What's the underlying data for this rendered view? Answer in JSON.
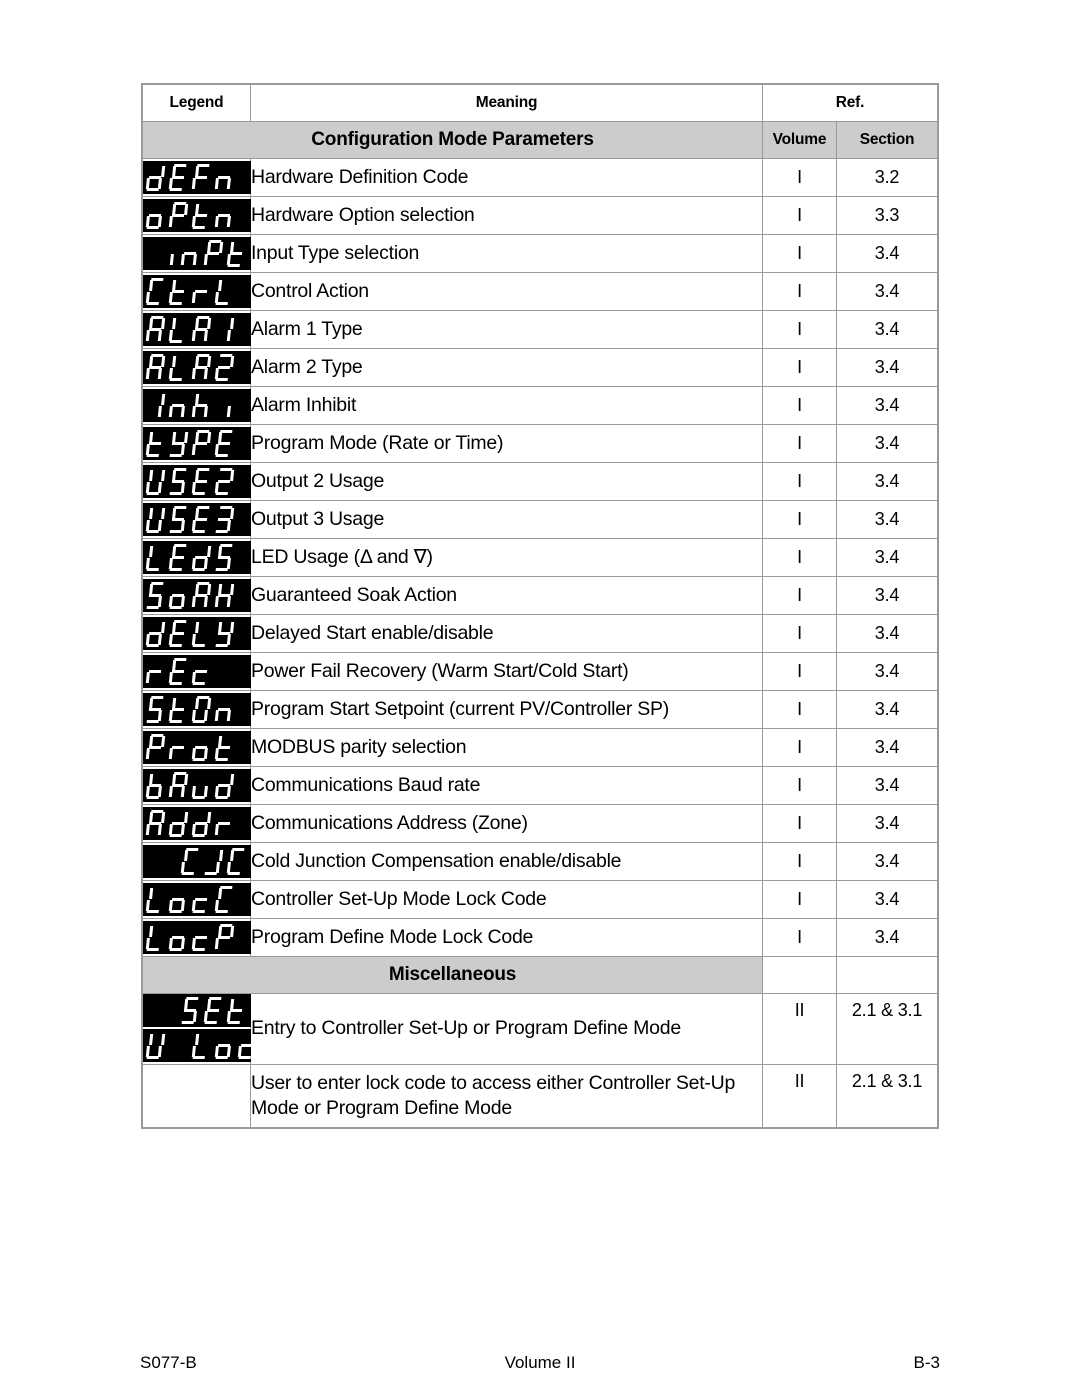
{
  "document": {
    "footer": {
      "left": "S077-B",
      "center": "Volume II",
      "right": "B-3"
    }
  },
  "table": {
    "headers": {
      "legend": "Legend",
      "meaning": "Meaning",
      "ref": "Ref.",
      "volume": "Volume",
      "section": "Section"
    },
    "groups": [
      {
        "title": "Configuration Mode Parameters",
        "rows": [
          {
            "legend": "dEFn",
            "align": "left",
            "meaning": "Hardware Definition Code",
            "volume": "I",
            "section": "3.2"
          },
          {
            "legend": "oPtn",
            "align": "left",
            "meaning": "Hardware Option selection",
            "volume": "I",
            "section": "3.3"
          },
          {
            "legend": "inPt",
            "align": "right",
            "meaning": "Input Type selection",
            "volume": "I",
            "section": "3.4"
          },
          {
            "legend": "CtrL",
            "align": "left",
            "meaning": "Control Action",
            "volume": "I",
            "section": "3.4"
          },
          {
            "legend": "ALA1",
            "align": "left",
            "meaning": "Alarm 1 Type",
            "volume": "I",
            "section": "3.4"
          },
          {
            "legend": "ALA2",
            "align": "left",
            "meaning": "Alarm 2 Type",
            "volume": "I",
            "section": "3.4"
          },
          {
            "legend": "Inhi",
            "align": "left",
            "meaning": "Alarm Inhibit",
            "volume": "I",
            "section": "3.4"
          },
          {
            "legend": "tYPE",
            "align": "left",
            "meaning": "Program Mode (Rate or Time)",
            "volume": "I",
            "section": "3.4"
          },
          {
            "legend": "USE2",
            "align": "left",
            "meaning": "Output 2 Usage",
            "volume": "I",
            "section": "3.4"
          },
          {
            "legend": "USE3",
            "align": "left",
            "meaning": "Output 3 Usage",
            "volume": "I",
            "section": "3.4"
          },
          {
            "legend": "LEdS",
            "align": "left",
            "meaning": "LED Usage (Δ and ∇)",
            "volume": "I",
            "section": "3.4"
          },
          {
            "legend": "SoAK",
            "align": "left",
            "meaning": "Guaranteed Soak Action",
            "volume": "I",
            "section": "3.4"
          },
          {
            "legend": "dELY",
            "align": "left",
            "meaning": "Delayed Start enable/disable",
            "volume": "I",
            "section": "3.4"
          },
          {
            "legend": "rEc",
            "align": "left",
            "meaning": "Power Fail Recovery (Warm Start/Cold Start)",
            "volume": "I",
            "section": "3.4"
          },
          {
            "legend": "StOn",
            "align": "left",
            "meaning": "Program Start Setpoint (current PV/Controller SP)",
            "volume": "I",
            "section": "3.4"
          },
          {
            "legend": "Prot",
            "align": "left",
            "meaning": "MODBUS parity selection",
            "volume": "I",
            "section": "3.4"
          },
          {
            "legend": "bAud",
            "align": "left",
            "meaning": "Communications Baud rate",
            "volume": "I",
            "section": "3.4"
          },
          {
            "legend": "Addr",
            "align": "left",
            "meaning": "Communications Address (Zone)",
            "volume": "I",
            "section": "3.4"
          },
          {
            "legend": "CJC",
            "align": "right",
            "meaning": "Cold Junction Compensation enable/disable",
            "volume": "I",
            "section": "3.4"
          },
          {
            "legend": "LocC",
            "align": "left",
            "meaning": "Controller Set-Up Mode Lock Code",
            "volume": "I",
            "section": "3.4"
          },
          {
            "legend": "LocP",
            "align": "left",
            "meaning": "Program Define Mode Lock Code",
            "volume": "I",
            "section": "3.4"
          }
        ]
      },
      {
        "title": "Miscellaneous",
        "rows": [
          {
            "legend": "SEt",
            "align": "right",
            "meaning": "Entry to Controller Set-Up or Program Define Mode",
            "volume": "II",
            "section": "2.1 & 3.1"
          },
          {
            "legend": "U loc",
            "align": "left",
            "meaning": "User to enter lock code to access either Controller Set-Up Mode or Program Define Mode",
            "volume": "II",
            "section": "2.1 & 3.1"
          }
        ]
      }
    ]
  }
}
